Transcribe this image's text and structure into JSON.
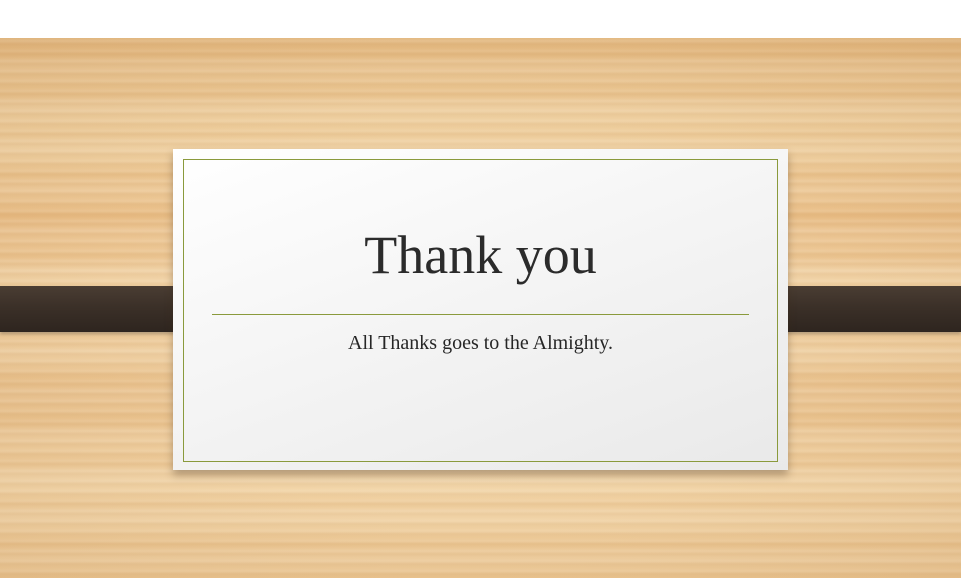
{
  "slide": {
    "title": "Thank you",
    "subtitle": "All Thanks goes to the Almighty."
  },
  "colors": {
    "accent_line": "#8a9a3c",
    "strap": "#3b3028",
    "card": "#f3f3f3",
    "text": "#2b2b2b",
    "background_wood": "#eec99a"
  }
}
